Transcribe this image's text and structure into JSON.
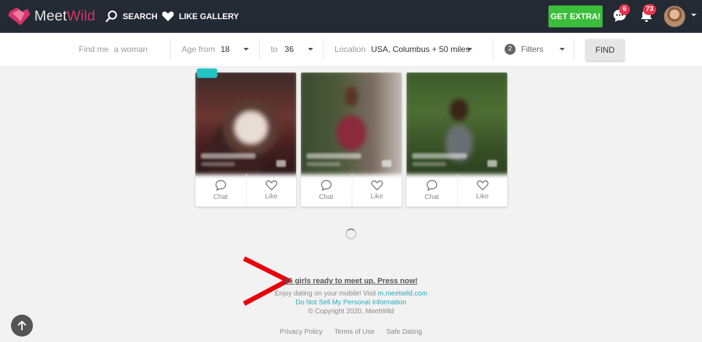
{
  "header": {
    "logo_left": "Meet",
    "logo_right": "Wild",
    "search_label": "SEARCH",
    "gallery_label": "LIKE GALLERY",
    "extra_label": "GET EXTRA!",
    "messages_count": "6",
    "notifications_count": "73"
  },
  "filters": {
    "find_me_label": "Find me",
    "find_me_value": "a woman",
    "age_from_label": "Age from",
    "age_from_value": "18",
    "age_to_label": "to",
    "age_to_value": "36",
    "location_label": "Location",
    "location_value": "USA, Columbus + 50 miles",
    "filters_count": "2",
    "filters_label": "Filters",
    "find_button": "FIND"
  },
  "cards": [
    {
      "chat": "Chat",
      "like": "Like"
    },
    {
      "chat": "Chat",
      "like": "Like"
    },
    {
      "chat": "Chat",
      "like": "Like"
    }
  ],
  "footer": {
    "promo": "16 girls ready to meet up. Press now!",
    "mobile_text": "Enjoy dating on your mobile! Visit",
    "mobile_link": "m.meetwild.com",
    "do_not_sell": "Do Not Sell My Personal Information",
    "copyright": "© Copyright 2020, MeetWild",
    "links": [
      "Privacy Policy",
      "Terms of Use",
      "Safe Dating"
    ]
  },
  "colors": {
    "topbar": "#232a33",
    "extra_button": "#3bbe3b",
    "badge": "#e8334d",
    "link": "#2aa8b8",
    "annotation": "#e8000b"
  }
}
